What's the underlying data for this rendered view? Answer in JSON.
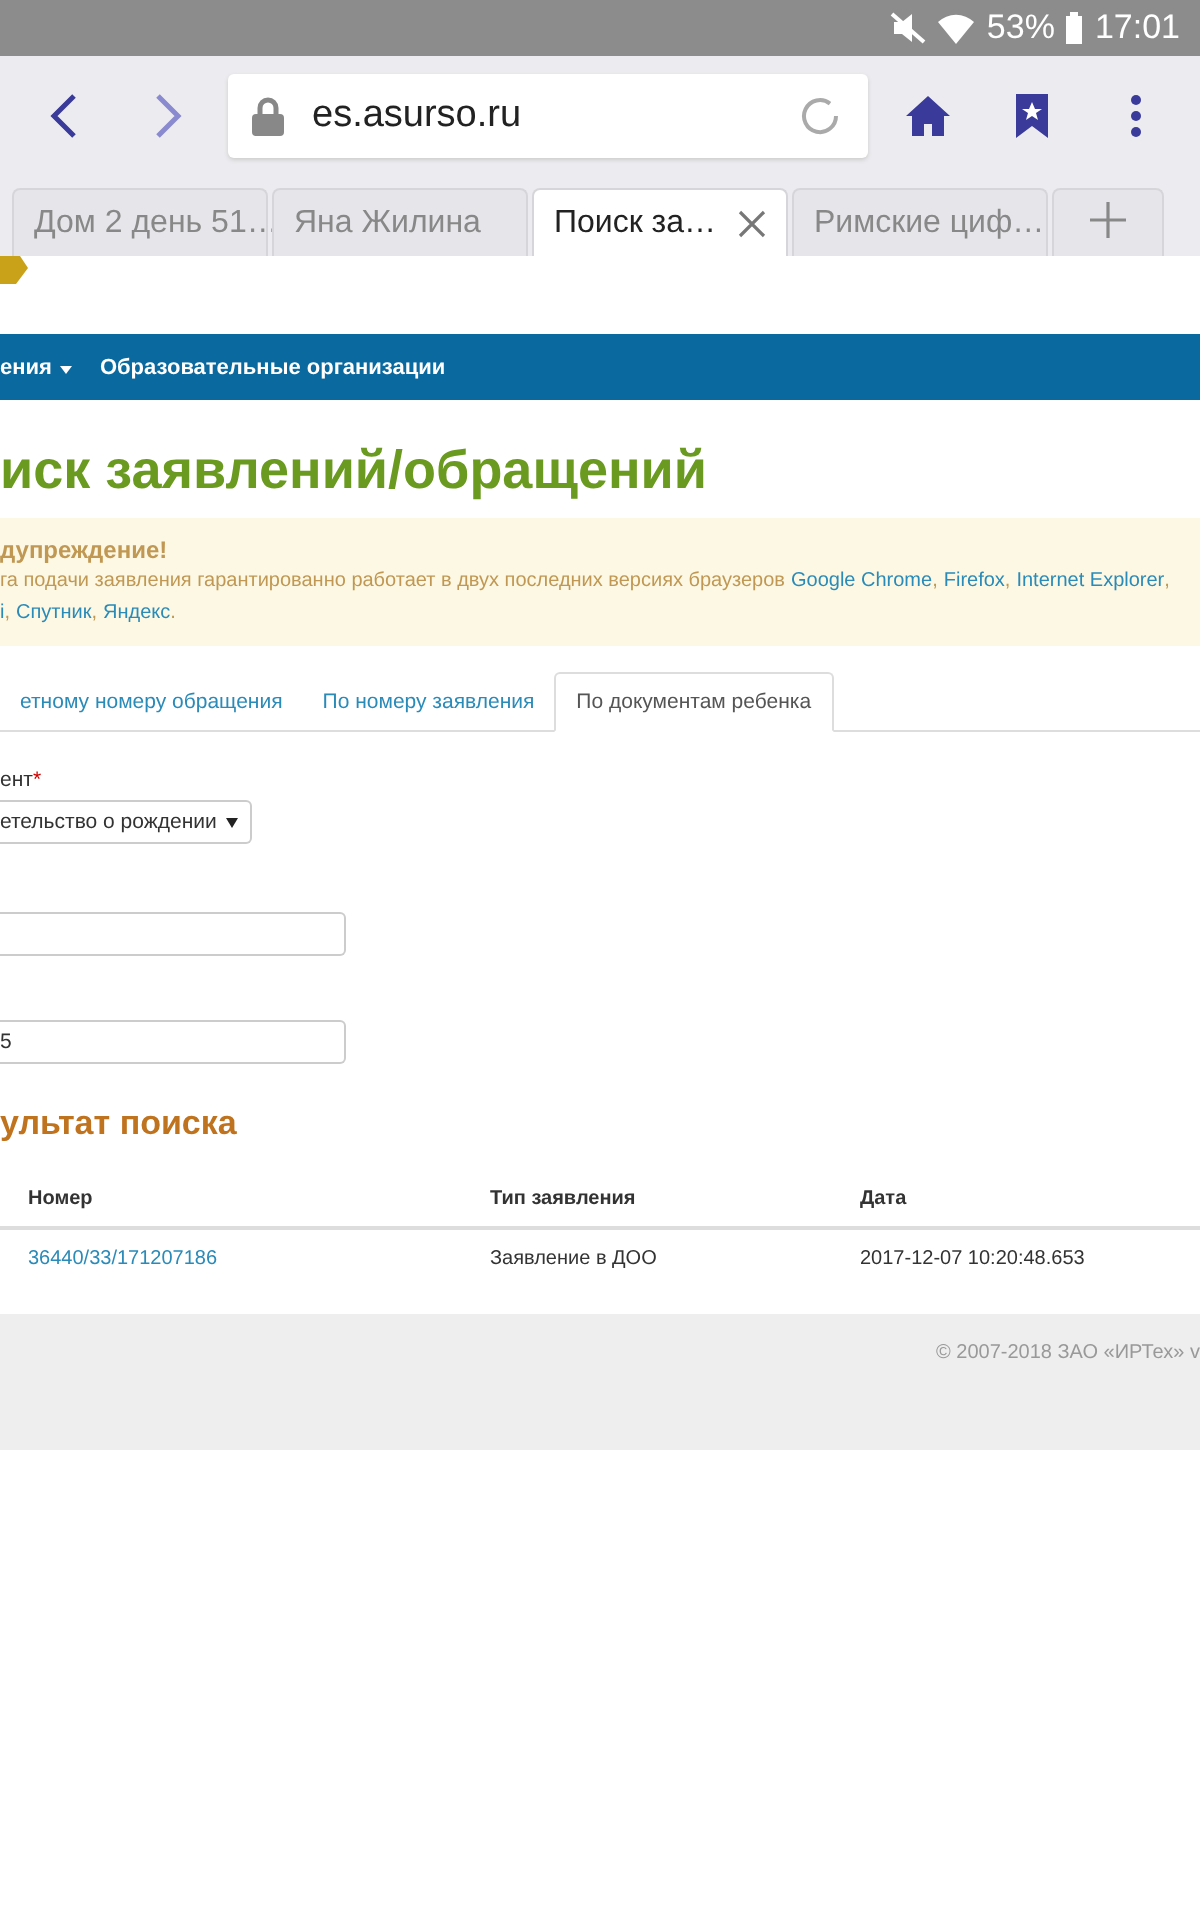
{
  "status_bar": {
    "battery": "53%",
    "time": "17:01"
  },
  "address_bar": {
    "url": "es.asurso.ru"
  },
  "browser_tabs": [
    {
      "title": "Дом 2 день 51…",
      "selected": false
    },
    {
      "title": "Яна Жилина",
      "selected": false
    },
    {
      "title": "Поиск за…",
      "selected": true
    },
    {
      "title": "Римские циф…",
      "selected": false
    }
  ],
  "nav": [
    "ения",
    "Образовательные организации"
  ],
  "page_title": "иск заявлений/обращений",
  "warning": {
    "title": "дупреждение!",
    "line1": [
      {
        "kind": "text",
        "text": "га подачи заявления гарантированно работает в двух последних версиях браузеров"
      },
      {
        "kind": "link",
        "text": "Google Chrome"
      },
      {
        "kind": "text",
        "text": ","
      },
      {
        "kind": "link",
        "text": "Firefox"
      },
      {
        "kind": "text",
        "text": ","
      },
      {
        "kind": "link",
        "text": "Internet Explorer"
      },
      {
        "kind": "text",
        "text": ","
      }
    ],
    "line2": [
      {
        "kind": "link",
        "text": "i"
      },
      {
        "kind": "text",
        "text": ","
      },
      {
        "kind": "link",
        "text": "Спутник"
      },
      {
        "kind": "text",
        "text": ","
      },
      {
        "kind": "link",
        "text": "Яндекс"
      },
      {
        "kind": "text",
        "text": "."
      }
    ]
  },
  "search_tabs": [
    {
      "label": "етному номеру обращения",
      "selected": false
    },
    {
      "label": "По номеру заявления",
      "selected": false
    },
    {
      "label": "По документам ребенка",
      "selected": true
    }
  ],
  "form": {
    "doc_label": "ент",
    "required_mark": "*",
    "doc_value": "етельство о рождении",
    "field_2_value": "5"
  },
  "results": {
    "title": "ультат поиска",
    "columns": [
      "Номер",
      "Тип заявления",
      "Дата"
    ],
    "rows": [
      [
        "36440/33/171207186",
        "Заявление в ДОО",
        "2017-12-07 10:20:48.653"
      ]
    ]
  },
  "footer": "© 2007-2018 ЗАО «ИРТех» v"
}
